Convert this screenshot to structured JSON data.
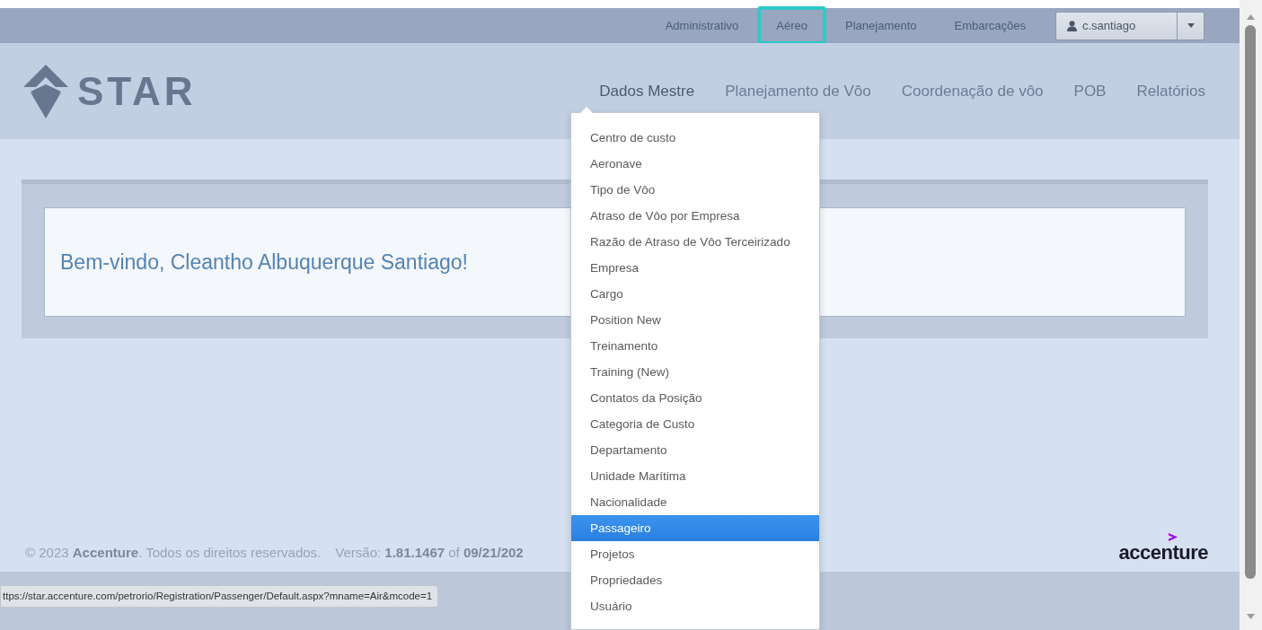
{
  "top_menu": [
    {
      "label": "Administrativo",
      "annotated": false
    },
    {
      "label": "Aéreo",
      "annotated": true
    },
    {
      "label": "Planejamento",
      "annotated": false
    },
    {
      "label": "Embarcações",
      "annotated": false
    }
  ],
  "user_menu": {
    "label": "c.santiago"
  },
  "logo": {
    "text": "STAR"
  },
  "main_nav": [
    {
      "label": "Dados Mestre",
      "selected": true
    },
    {
      "label": "Planejamento de Vôo",
      "selected": false
    },
    {
      "label": "Coordenação de vôo",
      "selected": false
    },
    {
      "label": "POB",
      "selected": false
    },
    {
      "label": "Relatórios",
      "selected": false
    }
  ],
  "dropdown": {
    "items": [
      {
        "label": "Centro de custo",
        "selected": false
      },
      {
        "label": "Aeronave",
        "selected": false
      },
      {
        "label": "Tipo de Vôo",
        "selected": false
      },
      {
        "label": "Atraso de Vôo por Empresa",
        "selected": false
      },
      {
        "label": "Razão de Atraso de Vôo Terceirizado",
        "selected": false
      },
      {
        "label": "Empresa",
        "selected": false
      },
      {
        "label": "Cargo",
        "selected": false
      },
      {
        "label": "Position New",
        "selected": false
      },
      {
        "label": "Treinamento",
        "selected": false
      },
      {
        "label": "Training (New)",
        "selected": false
      },
      {
        "label": "Contatos da Posição",
        "selected": false
      },
      {
        "label": "Categoria de Custo",
        "selected": false
      },
      {
        "label": "Departamento",
        "selected": false
      },
      {
        "label": "Unidade Marítima",
        "selected": false
      },
      {
        "label": "Nacionalidade",
        "selected": false
      },
      {
        "label": "Passageiro",
        "selected": true
      },
      {
        "label": "Projetos",
        "selected": false
      },
      {
        "label": "Propriedades",
        "selected": false
      },
      {
        "label": "Usuário",
        "selected": false
      }
    ]
  },
  "welcome": "Bem-vindo, Cleantho Albuquerque Santiago!",
  "footer": {
    "copyright": "© 2023 **Accenture**. Todos os direitos reservados.",
    "version": "Versão: **1.81.1467** of **09/21/202**",
    "brand": "accenture"
  },
  "status_url": "ttps://star.accenture.com/petrorio/Registration/Passenger/Default.aspx?mname=Air&mcode=1"
}
